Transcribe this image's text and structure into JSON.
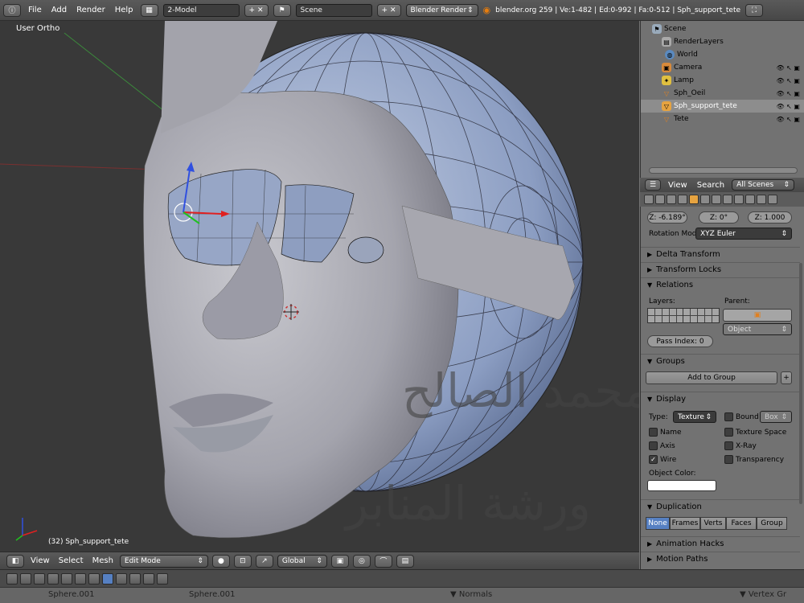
{
  "topbar": {
    "menus": [
      "File",
      "Add",
      "Render",
      "Help"
    ],
    "screen_layout": "2-Model",
    "scene": "Scene",
    "render_engine": "Blender Render",
    "stats": "blender.org 259 | Ve:1-482 | Ed:0-992 | Fa:0-512 | Sph_support_tete"
  },
  "viewport": {
    "view_label": "User Ortho",
    "object_label": "(32) Sph_support_tete",
    "watermark_line1": "محمد الصالح",
    "watermark_line2": "ورشة المنابر"
  },
  "viewport_header": {
    "menus": [
      "View",
      "Select",
      "Mesh"
    ],
    "mode": "Edit Mode",
    "orientation": "Global"
  },
  "outliner": {
    "items": [
      {
        "label": "Scene",
        "icon": "scene-icon"
      },
      {
        "label": "RenderLayers",
        "icon": "renderlayers-icon"
      },
      {
        "label": "World",
        "icon": "world-icon"
      },
      {
        "label": "Camera",
        "icon": "camera-icon"
      },
      {
        "label": "Lamp",
        "icon": "lamp-icon"
      },
      {
        "label": "Sph_Oeil",
        "icon": "mesh-icon"
      },
      {
        "label": "Sph_support_tete",
        "icon": "mesh-icon"
      },
      {
        "label": "Tete",
        "icon": "mesh-icon"
      }
    ]
  },
  "props_header": {
    "view": "View",
    "search": "Search",
    "scenes": "All Scenes"
  },
  "properties": {
    "rot_z": "Z: -6.189°",
    "delta_z": "Z: 0°",
    "scale_z": "Z: 1.000",
    "rotation_mode_label": "Rotation Mod",
    "rotation_mode": "XYZ Euler",
    "delta_transform": "Delta Transform",
    "transform_locks": "Transform Locks",
    "relations": "Relations",
    "layers_label": "Layers:",
    "parent_label": "Parent:",
    "parent_type": "Object",
    "pass_index": "Pass Index: 0",
    "groups": "Groups",
    "add_to_group": "Add to Group",
    "display": "Display",
    "type_label": "Type:",
    "type_value": "Texture",
    "bound_label": "Bound",
    "bound_value": "Box",
    "name": "Name",
    "texture_space": "Texture Space",
    "axis": "Axis",
    "xray": "X-Ray",
    "wire": "Wire",
    "transparency": "Transparency",
    "object_color": "Object Color:",
    "duplication": "Duplication",
    "dup_options": [
      "None",
      "Frames",
      "Verts",
      "Faces",
      "Group"
    ],
    "animation_hacks": "Animation Hacks",
    "motion_paths": "Motion Paths"
  },
  "bottom": {
    "item_a": "Sphere.001",
    "item_b": "Sphere.001",
    "normals": "Normals",
    "vertex_groups": "Vertex Gr"
  }
}
